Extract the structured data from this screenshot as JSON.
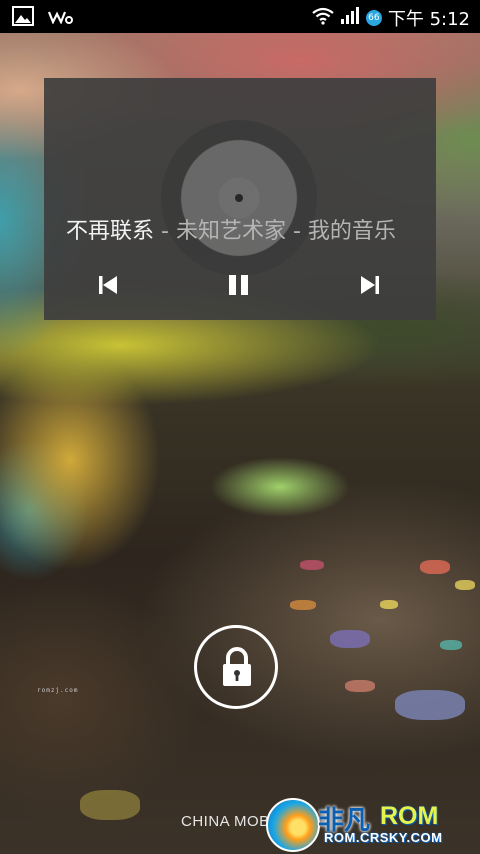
{
  "status_bar": {
    "time": "下午 5:12",
    "badge": "66",
    "icons": [
      "gallery-icon",
      "walkman-icon",
      "wifi-icon",
      "signal-icon"
    ]
  },
  "music_widget": {
    "title": "不再联系",
    "separator": " - ",
    "artist": "未知艺术家",
    "album": "我的音乐",
    "playback": "paused",
    "controls": [
      "previous-icon",
      "pause-icon",
      "next-icon"
    ]
  },
  "lock": {
    "icon": "padlock-icon"
  },
  "carrier": "CHINA MOBILE",
  "watermark": {
    "small_text": "romzj.com",
    "logo_cn": "非凡",
    "logo_rom": "ROM",
    "logo_url": "ROM.CRSKY.COM"
  },
  "colors": {
    "widget_bg": "#3e3e3e",
    "status_bar_bg": "#000000",
    "badge": "#2aa7e0"
  }
}
